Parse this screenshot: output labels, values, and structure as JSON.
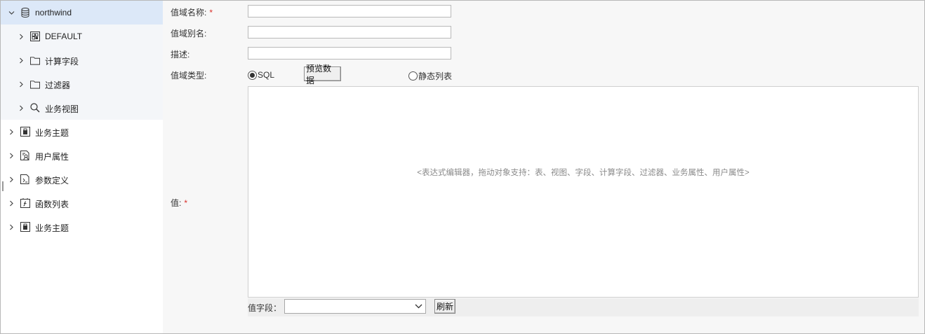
{
  "tree": {
    "root": {
      "label": "northwind",
      "icon": "database-icon",
      "expanded": true
    },
    "children": [
      {
        "label": "DEFAULT",
        "icon": "table-icon"
      },
      {
        "label": "计算字段",
        "icon": "folder-icon"
      },
      {
        "label": "过滤器",
        "icon": "folder-icon"
      },
      {
        "label": "业务视图",
        "icon": "search-icon"
      }
    ],
    "top_items": [
      {
        "label": "业务主题",
        "icon": "business-topic-icon"
      },
      {
        "label": "用户属性",
        "icon": "user-attribute-icon"
      },
      {
        "label": "参数定义",
        "icon": "parameter-icon"
      },
      {
        "label": "函数列表",
        "icon": "function-icon"
      },
      {
        "label": "业务主题",
        "icon": "business-topic-icon"
      }
    ]
  },
  "form": {
    "name_label": "值域名称:",
    "alias_label": "值域别名:",
    "desc_label": "描述:",
    "type_label": "值域类型:",
    "value_label": "值:",
    "required_mark": "*",
    "name_value": "",
    "alias_value": "",
    "desc_value": "",
    "radio_sql": "SQL",
    "radio_static": "静态列表",
    "preview_button": "预览数据",
    "editor_placeholder": "<表达式编辑器，拖动对象支持：表、视图、字段、计算字段、过滤器、业务属性、用户属性>",
    "value_field_label": "值字段：",
    "value_field_selected": "",
    "refresh_button": "刷新"
  },
  "colors": {
    "selected_row": "#dce8f8",
    "required": "#d9302b"
  }
}
